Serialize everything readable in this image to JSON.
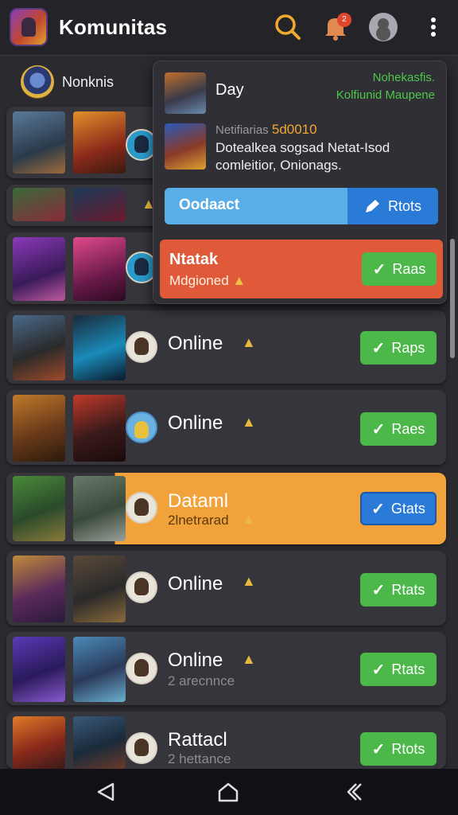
{
  "header": {
    "title": "Komunitas",
    "notification_count": "2",
    "icons": [
      "app-logo",
      "search-icon",
      "bell-icon",
      "avatar",
      "more-vert-icon"
    ]
  },
  "filter": {
    "label": "Nonknis"
  },
  "dropdown": {
    "day_label": "Day",
    "status_line1": "Nohekasfis.",
    "status_line2": "Kolfiunid Maupene",
    "note_head": "Netifiarias",
    "note_count": "5d0010",
    "note_body": "Dotealkea sogsad Netat-Isod comleitior, Onionags.",
    "blue_label": "Oodaact",
    "blue_button": "Rtots",
    "red_title": "Ntatak",
    "red_sub": "Mdgioned",
    "red_button": "Raas"
  },
  "rows": [
    {
      "name": "",
      "sub": "",
      "button": "",
      "thumbs_up": false
    },
    {
      "name": "",
      "sub": "",
      "button": "",
      "thumbs_up": true
    },
    {
      "name": "",
      "sub": "",
      "button": "",
      "thumbs_up": false
    },
    {
      "name": "Online",
      "sub": "",
      "button": "Raps",
      "thumbs_up": true
    },
    {
      "name": "Online",
      "sub": "",
      "button": "Raes",
      "thumbs_up": true
    },
    {
      "name": "Dataml",
      "sub": "2lnetrarad",
      "button": "Gtats",
      "thumbs_up": true,
      "highlighted": true
    },
    {
      "name": "Online",
      "sub": "",
      "button": "Rtats",
      "thumbs_up": true
    },
    {
      "name": "Online",
      "sub": "2 arecnnce",
      "button": "Rtats",
      "thumbs_up": true
    },
    {
      "name": "Rattacl",
      "sub": "2 hettance",
      "button": "Rtots",
      "thumbs_up": false
    }
  ],
  "colors": {
    "background": "#2b2a2f",
    "accent_green": "#4cb84a",
    "accent_blue": "#2a7ad8",
    "highlight_orange": "#f2a23a",
    "panel_red": "#e05a3a",
    "search_orange": "#f0a830"
  },
  "navbar": {
    "icons": [
      "back-icon",
      "home-icon",
      "recent-apps-icon"
    ]
  }
}
